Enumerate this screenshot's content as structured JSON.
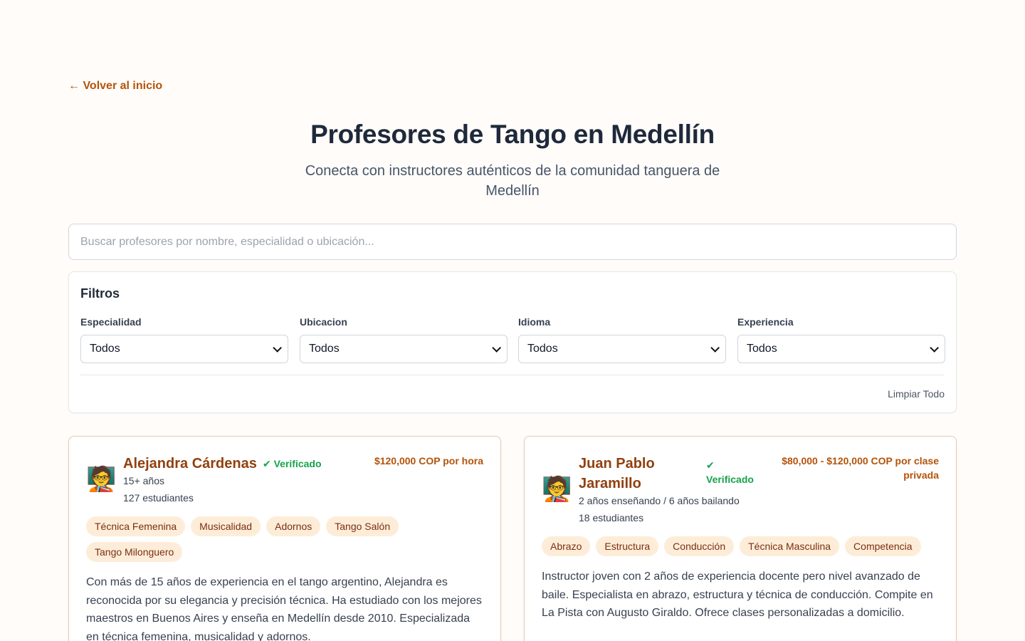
{
  "nav": {
    "back_label": "← Volver al inicio"
  },
  "header": {
    "title": "Profesores de Tango en Medellín",
    "subtitle": "Conecta con instructores auténticos de la comunidad tanguera de Medellín"
  },
  "search": {
    "placeholder": "Buscar profesores por nombre, especialidad o ubicación..."
  },
  "filters": {
    "title": "Filtros",
    "groups": [
      {
        "label": "Especialidad",
        "value": "Todos"
      },
      {
        "label": "Ubicacion",
        "value": "Todos"
      },
      {
        "label": "Idioma",
        "value": "Todos"
      },
      {
        "label": "Experiencia",
        "value": "Todos"
      }
    ],
    "clear_label": "Limpiar Todo"
  },
  "teachers": [
    {
      "avatar": "🧑‍🏫",
      "name": "Alejandra Cárdenas",
      "verified": "✔ Verificado",
      "price": "$120,000 COP por hora",
      "experience": "15+ años",
      "students": "127 estudiantes",
      "tags": [
        "Técnica Femenina",
        "Musicalidad",
        "Adornos",
        "Tango Salón",
        "Tango Milonguero"
      ],
      "description": "Con más de 15 años de experiencia en el tango argentino, Alejandra es reconocida por su elegancia y precisión técnica. Ha estudiado con los mejores maestros en Buenos Aires y enseña en Medellín desde 2010. Especializada en técnica femenina, musicalidad y adornos."
    },
    {
      "avatar": "🧑‍🏫",
      "name": "Juan Pablo Jaramillo",
      "verified": "✔ Verificado",
      "price": "$80,000 - $120,000 COP por clase privada",
      "experience": "2 años enseñando / 6 años bailando",
      "students": "18 estudiantes",
      "tags": [
        "Abrazo",
        "Estructura",
        "Conducción",
        "Técnica Masculina",
        "Competencia"
      ],
      "description": "Instructor joven con 2 años de experiencia docente pero nivel avanzado de baile. Especialista en abrazo, estructura y técnica de conducción. Compite en La Pista con Augusto Giraldo. Ofrece clases personalizadas a domicilio."
    }
  ]
}
